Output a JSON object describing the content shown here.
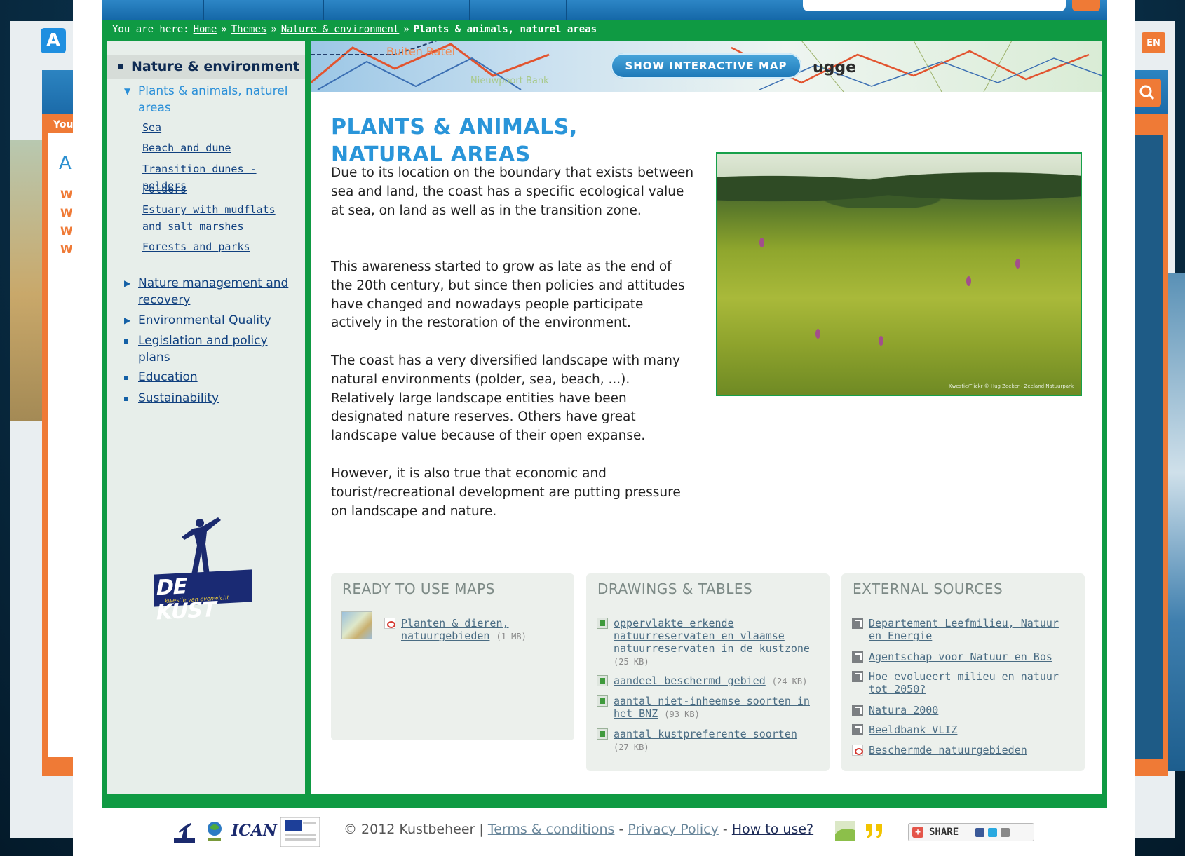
{
  "background": {
    "a_icon": "A",
    "you_text": "You",
    "a_letter": "A",
    "w_letters": [
      "W",
      "W",
      "W",
      "W"
    ],
    "lang": "EN",
    "search_icon": "search-icon"
  },
  "breadcrumb": {
    "prefix": "You are here:",
    "items": [
      "Home",
      "Themes",
      "Nature & environment"
    ],
    "separator": "»",
    "current": "Plants & animals, naturel areas"
  },
  "sidebar": {
    "heading": "Nature & environment",
    "active_item": "Plants & animals, naturel areas",
    "sub_items": [
      "Sea",
      "Beach and dune",
      "Transition dunes - polders",
      "Polders",
      "Estuary with mudflats and salt marshes",
      "Forests and parks"
    ],
    "items": [
      "Nature management and recovery",
      "Environmental Quality",
      "Legislation and policy plans",
      "Education",
      "Sustainability"
    ],
    "logo": {
      "title": "DE KUST",
      "tagline": "kwestie van evenwicht"
    }
  },
  "map_strip": {
    "button_label": "SHOW INTERACTIVE MAP",
    "city_label": "ugge",
    "place_labels": [
      "Buiten Ratel",
      "Nieuwpoort Bank"
    ]
  },
  "main": {
    "title": "PLANTS & ANIMALS, NATURAL AREAS",
    "paragraphs": [
      "Due to its location on the boundary that exists between sea and land, the coast has a specific ecological value at sea, on land as well as in the transition zone.",
      "This awareness started to grow as late as the end of the 20th century, but since then policies and attitudes have changed and nowadays people participate actively in the restoration of the environment.",
      "The coast has a very diversified landscape with many natural environments (polder, sea, beach, ...). Relatively large landscape entities have been designated nature reserves. Others have great landscape value because of their open expanse.",
      "However, it is also true that economic and tourist/recreational development are putting pressure on landscape and nature."
    ],
    "photo_credit": "Kwestie/Flickr © Hug Zeeker - Zeeland Natuurpark"
  },
  "boxes": {
    "maps": {
      "title": "READY TO USE MAPS",
      "items": [
        {
          "label": "Planten & dieren, natuurgebieden",
          "size": "(1 MB)",
          "icon": "pdf-icon"
        }
      ]
    },
    "drawings": {
      "title": "DRAWINGS & TABLES",
      "items": [
        {
          "label": "oppervlakte erkende natuurreservaten en vlaamse natuurreservaten in de kustzone",
          "size": "(25 KB)",
          "icon": "spreadsheet-icon"
        },
        {
          "label": "aandeel beschermd gebied",
          "size": "(24 KB)",
          "icon": "spreadsheet-icon"
        },
        {
          "label": "aantal niet-inheemse soorten in het BNZ",
          "size": "(93 KB)",
          "icon": "spreadsheet-icon"
        },
        {
          "label": "aantal kustpreferente soorten",
          "size": "(27 KB)",
          "icon": "spreadsheet-icon"
        }
      ]
    },
    "external": {
      "title": "EXTERNAL SOURCES",
      "items": [
        {
          "label": "Departement Leefmilieu, Natuur en Energie",
          "icon": "external-link-icon"
        },
        {
          "label": "Agentschap voor Natuur en Bos",
          "icon": "external-link-icon"
        },
        {
          "label": "Hoe evolueert milieu en natuur tot 2050?",
          "icon": "external-link-icon"
        },
        {
          "label": "Natura 2000",
          "icon": "external-link-icon"
        },
        {
          "label": "Beeldbank VLIZ",
          "icon": "external-link-icon"
        },
        {
          "label": "Beschermde natuurgebieden",
          "icon": "pdf-icon"
        }
      ]
    }
  },
  "footer": {
    "copyright": "© 2012 Kustbeheer |",
    "terms": "Terms & conditions",
    "dash1": "-",
    "privacy": "Privacy Policy",
    "dash2": "-",
    "howto": "How to use?",
    "share": "SHARE",
    "ican": "ICAN"
  },
  "colors": {
    "frame_green": "#0f9a43",
    "title_blue": "#2a95d9",
    "link_navy": "#10407f",
    "accent_orange": "#ef7a36"
  }
}
